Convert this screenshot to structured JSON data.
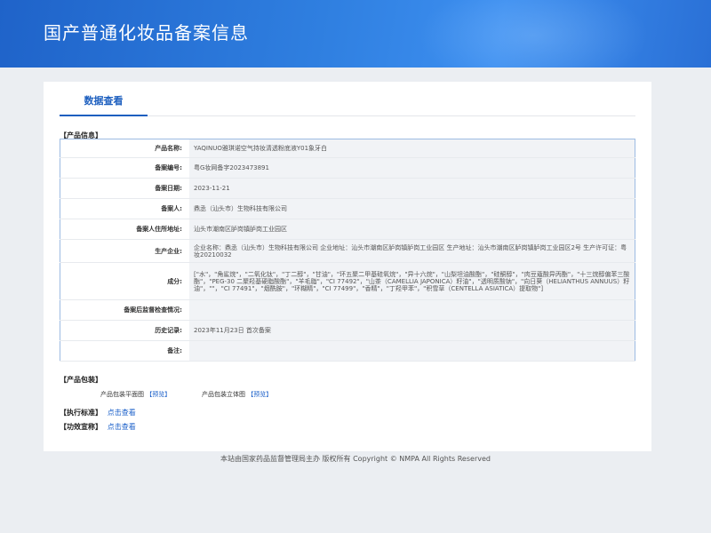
{
  "header": {
    "title": "国产普通化妆品备案信息"
  },
  "tabs": [
    {
      "label": "数据查看"
    }
  ],
  "product_section": {
    "title": "【产品信息】",
    "rows": [
      {
        "label": "产品名称:",
        "value": "YAQINUO雅琪诺空气持妆清透粉底液Y01象牙白"
      },
      {
        "label": "备案编号:",
        "value": "粤G妆网备字2023473891"
      },
      {
        "label": "备案日期:",
        "value": "2023-11-21"
      },
      {
        "label": "备案人:",
        "value": "鼎丞（汕头市）生物科技有限公司"
      },
      {
        "label": "备案人住所地址:",
        "value": "汕头市潮南区胪岗镇胪岗工业园区"
      },
      {
        "label": "生产企业:",
        "value": "企业名称：鼎丞（汕头市）生物科技有限公司 企业地址：汕头市潮南区胪岗镇胪岗工业园区 生产地址：汕头市潮南区胪岗镇胪岗工业园区2号 生产许可证：粤妆20210032"
      },
      {
        "label": "成分:",
        "value": "[\"水\"，\"角鲨烷\"，\"二氧化钛\"，\"丁二醇\"，\"甘油\"，\"环五聚二甲基硅氧烷\"，\"异十六烷\"，\"山梨坦油酸酯\"，\"硅酮醇\"，\"肉豆蔻酸异丙酯\"，\"十三烷醇偏苯三酸酯\"，\"PEG-30 二聚羟基硬脂酸酯\"，\"羊毛脂\"，\"CI 77492\"，\"山茶（CAMELLIA JAPONICA）籽油\"，\"透明质酸钠\"，\"向日葵（HELIANTHUS ANNUUS）籽油\"，\"\"，\"CI 77491\"，\"烟酰胺\"，\"环糊精\"，\"CI 77499\"，\"香精\"，\"丁羟甲苯\"，\"积雪草（CENTELLA ASIATICA）提取物\"]"
      },
      {
        "label": "备案后监督检查情况:",
        "value": ""
      },
      {
        "label": "历史记录:",
        "value": "2023年11月23日 首次备案"
      },
      {
        "label": "备注:",
        "value": ""
      }
    ]
  },
  "packaging": {
    "title": "【产品包装】",
    "flat_label": "产品包装平面图",
    "flat_link": "【预览】",
    "solid_label": "产品包装立体图",
    "solid_link": "【预览】"
  },
  "standard": {
    "title": "【执行标准】",
    "link": "点击查看"
  },
  "efficacy": {
    "title": "【功效宣称】",
    "link": "点击查看"
  },
  "footer": {
    "text": "本站由国家药品监督管理局主办 版权所有 Copyright © NMPA All Rights Reserved"
  }
}
